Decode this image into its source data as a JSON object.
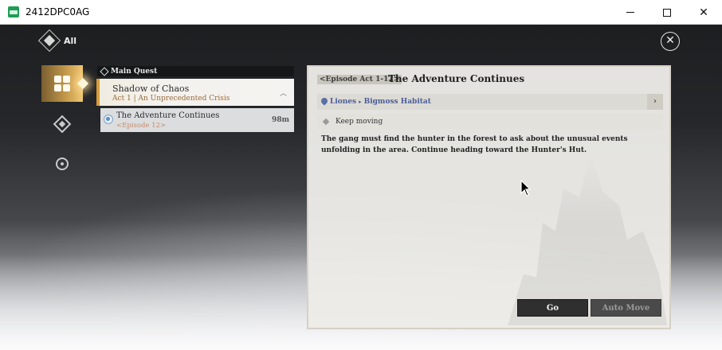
{
  "window": {
    "title": "2412DPC0AG",
    "minimize_icon": "minimize-icon",
    "maximize_icon": "maximize-icon",
    "close_glyph": "✕"
  },
  "game": {
    "top_left_label": "All",
    "close_glyph": "✕",
    "nav": [
      {
        "icon": "quest-grid-icon",
        "active": true
      },
      {
        "icon": "diamond-icon",
        "active": false
      },
      {
        "icon": "compass-icon",
        "active": false
      }
    ],
    "quest_list": {
      "section_label": "Main Quest",
      "group": {
        "title": "Shadow of Chaos",
        "subtitle": "Act 1 | An Unprecedented Crisis",
        "chevron": "︿"
      },
      "item": {
        "title": "The Adventure Continues",
        "subtitle": "<Episode 12>",
        "distance": "98m"
      }
    },
    "detail": {
      "episode_tag": "<Episode Act 1-12>",
      "title": "The Adventure Continues",
      "location": {
        "region": "Liones",
        "separator": "▸",
        "area": "Bigmoss Habitat",
        "arrow": "›"
      },
      "objective": "Keep moving",
      "description": "The gang must find the hunter in the forest to ask about the unusual events unfolding in the area. Continue heading toward the Hunter's Hut.",
      "go_button": "Go",
      "auto_move_button": "Auto Move"
    },
    "colors": {
      "accent_gold": "#d89c3a",
      "location_blue": "#4b5e9a"
    }
  }
}
